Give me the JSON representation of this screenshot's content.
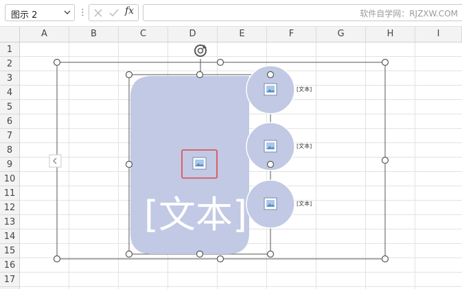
{
  "formula_bar": {
    "name_box_value": "图示 2",
    "menu_glyph": "⋮",
    "fx_label": "fx",
    "formula_value": "",
    "watermark": "软件自学网：RJZXW.COM"
  },
  "columns": [
    "A",
    "B",
    "C",
    "D",
    "E",
    "F",
    "G",
    "H",
    "I"
  ],
  "rows": [
    "1",
    "2",
    "3",
    "4",
    "5",
    "6",
    "7",
    "8",
    "9",
    "10",
    "11",
    "12",
    "13",
    "14",
    "15",
    "16",
    "17"
  ],
  "smartart": {
    "main_text": "[文本]",
    "side_items": [
      {
        "text": "[文本]"
      },
      {
        "text": "[文本]"
      },
      {
        "text": "[文本]"
      }
    ],
    "colors": {
      "shape_fill": "#c1c9e4",
      "frame": "#555555",
      "highlight": "#e0454a",
      "text": "#ffffff"
    },
    "icons": {
      "rotate": "rotate-handle-icon",
      "expand": "chevron-left-icon",
      "picture": "picture-placeholder-icon"
    }
  }
}
